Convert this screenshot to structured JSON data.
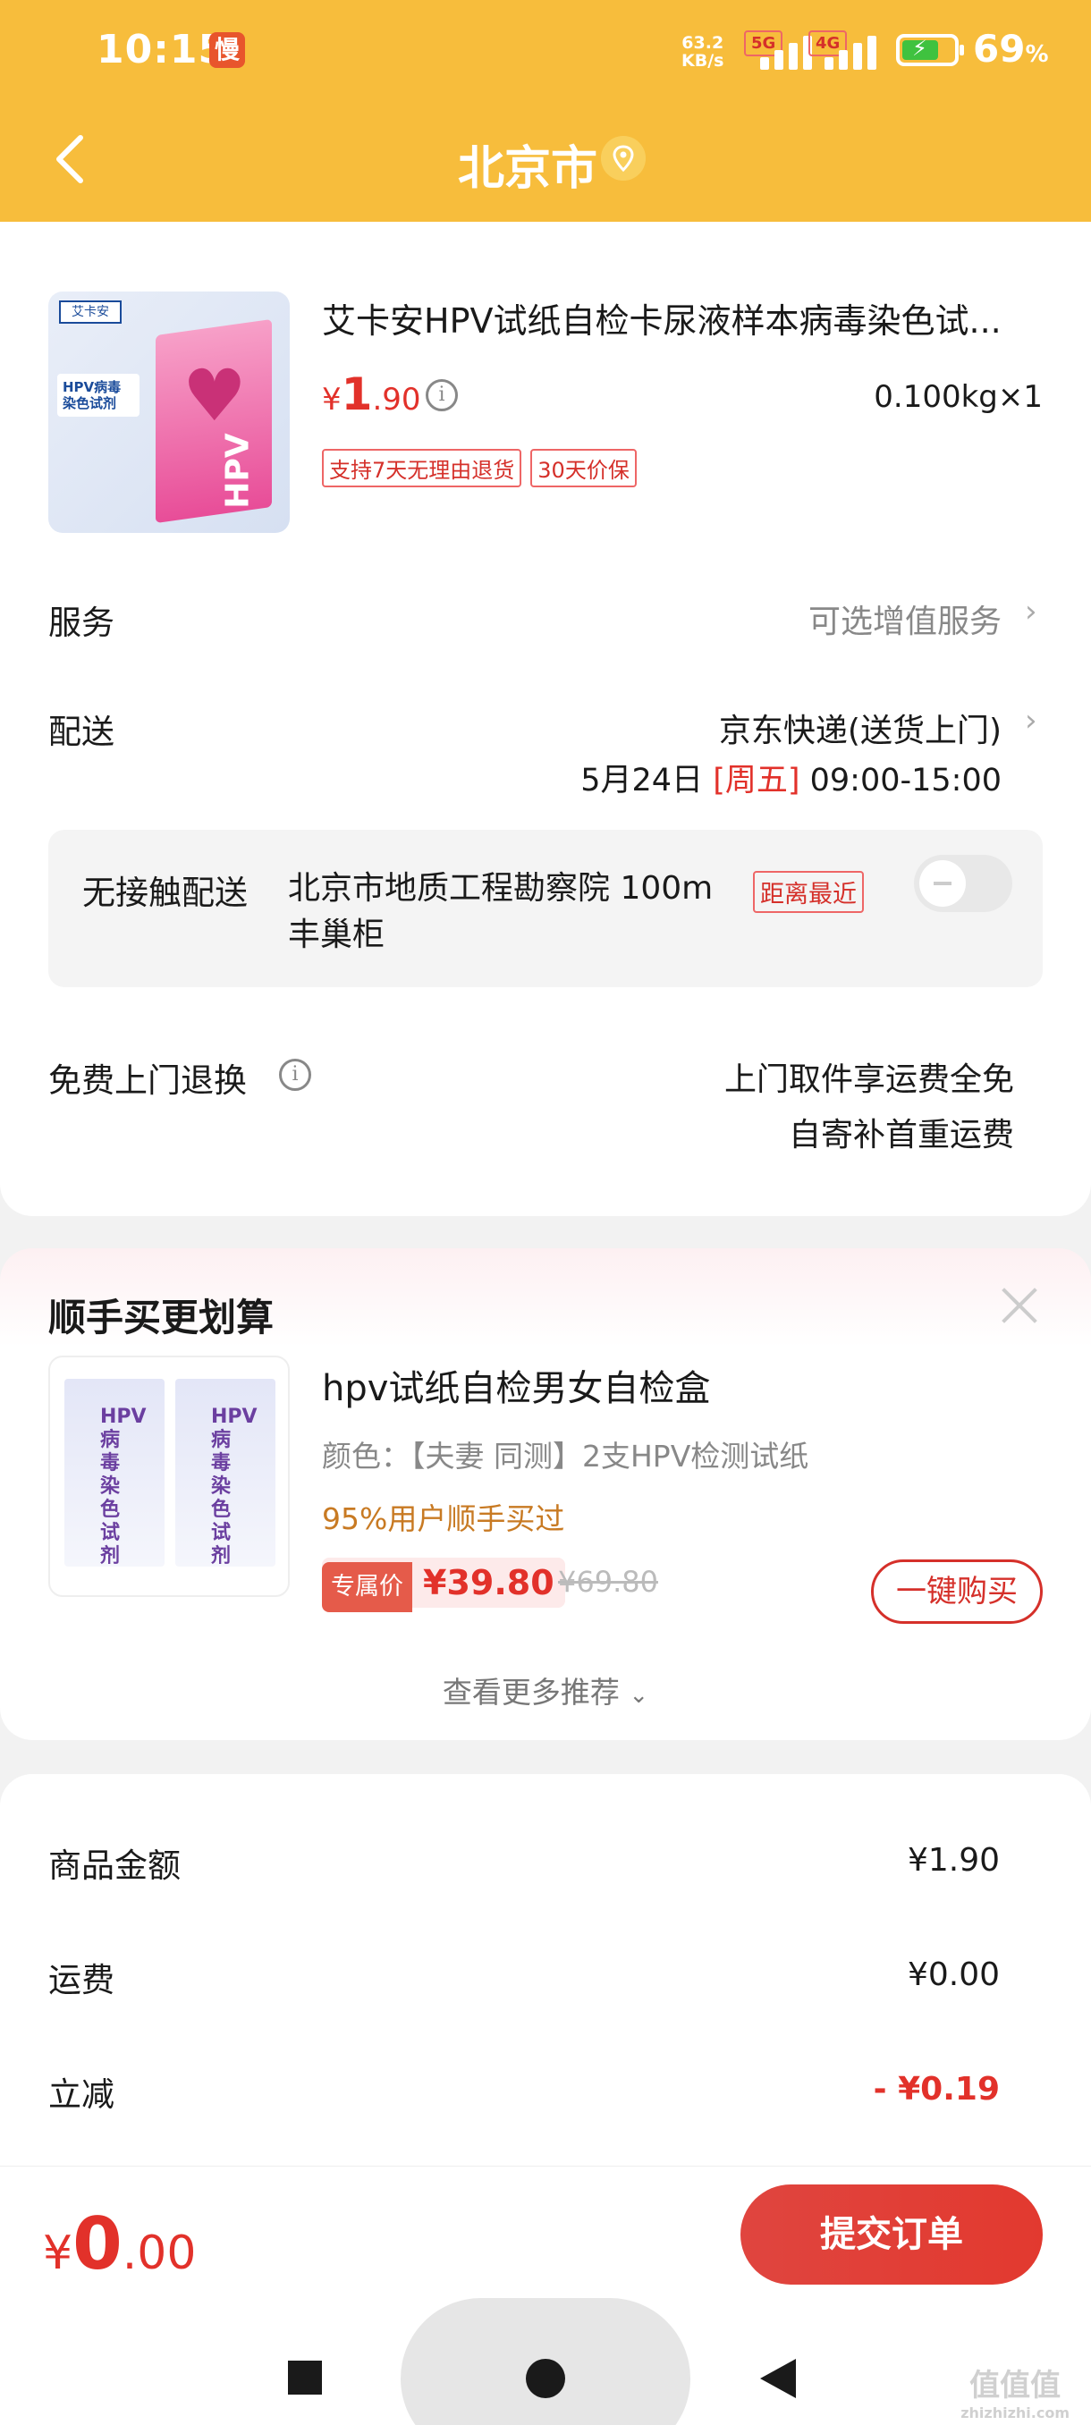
{
  "status_bar": {
    "time": "10:15",
    "slow_badge": "慢",
    "net_speed_value": "63.2",
    "net_speed_unit": "KB/s",
    "sig1_tag": "5G",
    "sig2_tag": "4G",
    "battery_pct": "69",
    "battery_unit": "%"
  },
  "header": {
    "title": "北京市"
  },
  "product": {
    "title": "艾卡安HPV试纸自检卡尿液样本病毒染色试...",
    "price_symbol": "¥",
    "price_int": "1",
    "price_dec": ".90",
    "weight": "0.100kg×1",
    "tags": [
      "支持7天无理由退货",
      "30天价保"
    ],
    "img_brand": "艾卡安",
    "img_label": "HPV病毒染色试剂",
    "img_hpv": "HPV"
  },
  "service": {
    "label": "服务",
    "value": "可选增值服务"
  },
  "delivery": {
    "label": "配送",
    "method": "京东快递(送货上门)",
    "date": "5月24日",
    "weekday": "[周五]",
    "time": "09:00-15:00"
  },
  "contactless": {
    "label": "无接触配送",
    "address": "北京市地质工程勘察院  100m",
    "address2": "丰巢柜",
    "nearest_badge": "距离最近",
    "enabled": false
  },
  "free_return": {
    "label": "免费上门退换",
    "line1": "上门取件享运费全免",
    "line2": "自寄补首重运费"
  },
  "recommend": {
    "title": "顺手买更划算",
    "name": "hpv试纸自检男女自检盒",
    "color": "颜色：【夫妻 同测】2支HPV检测试纸",
    "bought": "95%用户顺手买过",
    "exclusive_badge": "专属价",
    "price": "¥39.80",
    "old_price": "¥69.80",
    "buy_label": "一键购买",
    "more_label": "查看更多推荐",
    "img_text": "HPV病毒染色试剂"
  },
  "totals": {
    "goods_label": "商品金额",
    "goods_value": "¥1.90",
    "shipping_label": "运费",
    "shipping_value": "¥0.00",
    "discount_label": "立减",
    "discount_value": "- ¥0.19"
  },
  "bottom": {
    "symbol": "¥",
    "int": "0",
    "dec": ".00",
    "submit_label": "提交订单"
  },
  "watermark": {
    "text": "值值值",
    "sub": "zhizhizhi.com"
  }
}
